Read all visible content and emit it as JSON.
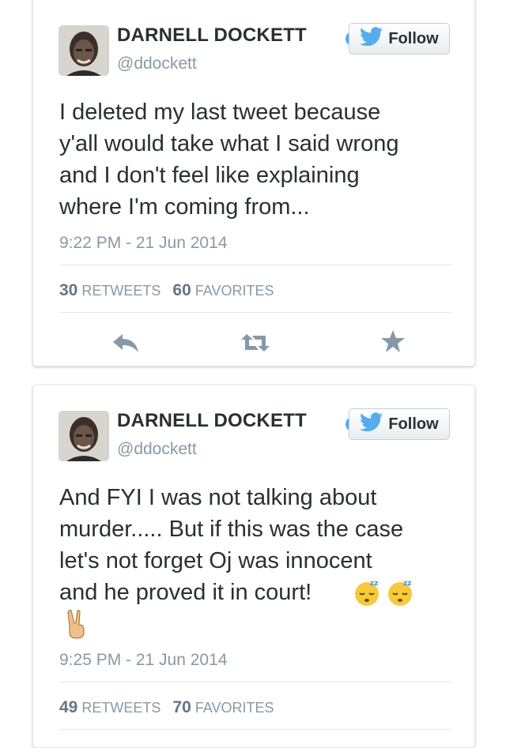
{
  "tweets": [
    {
      "author_name": "DARNELL DOCKETT",
      "handle": "@ddockett",
      "follow_label": "Follow",
      "lines": [
        "I deleted my last tweet because",
        "y'all would take what I said wrong",
        "and I don't feel like explaining",
        "where I'm coming from..."
      ],
      "timestamp": "9:22 PM - 21 Jun 2014",
      "retweets": "30",
      "retweets_label": "RETWEETS",
      "favorites": "60",
      "favorites_label": "FAVORITES",
      "actions": [
        "reply-icon",
        "retweet-icon",
        "favorite-icon"
      ]
    },
    {
      "author_name": "DARNELL DOCKETT",
      "handle": "@ddockett",
      "follow_label": "Follow",
      "lines": [
        "And FYI I was not talking about",
        "murder..... But if this was the case",
        "let's not forget Oj was innocent",
        "and he proved it in court!"
      ],
      "emojis": [
        "sleeping-face-emoji",
        "sleeping-face-emoji",
        "victory-hand-emoji"
      ],
      "timestamp": "9:25 PM - 21 Jun 2014",
      "retweets": "49",
      "retweets_label": "RETWEETS",
      "favorites": "70",
      "favorites_label": "FAVORITES"
    }
  ],
  "colors": {
    "text": "#292f33",
    "muted": "#8899a6",
    "twitter_blue": "#55acee",
    "divider": "#e1e8ed"
  }
}
